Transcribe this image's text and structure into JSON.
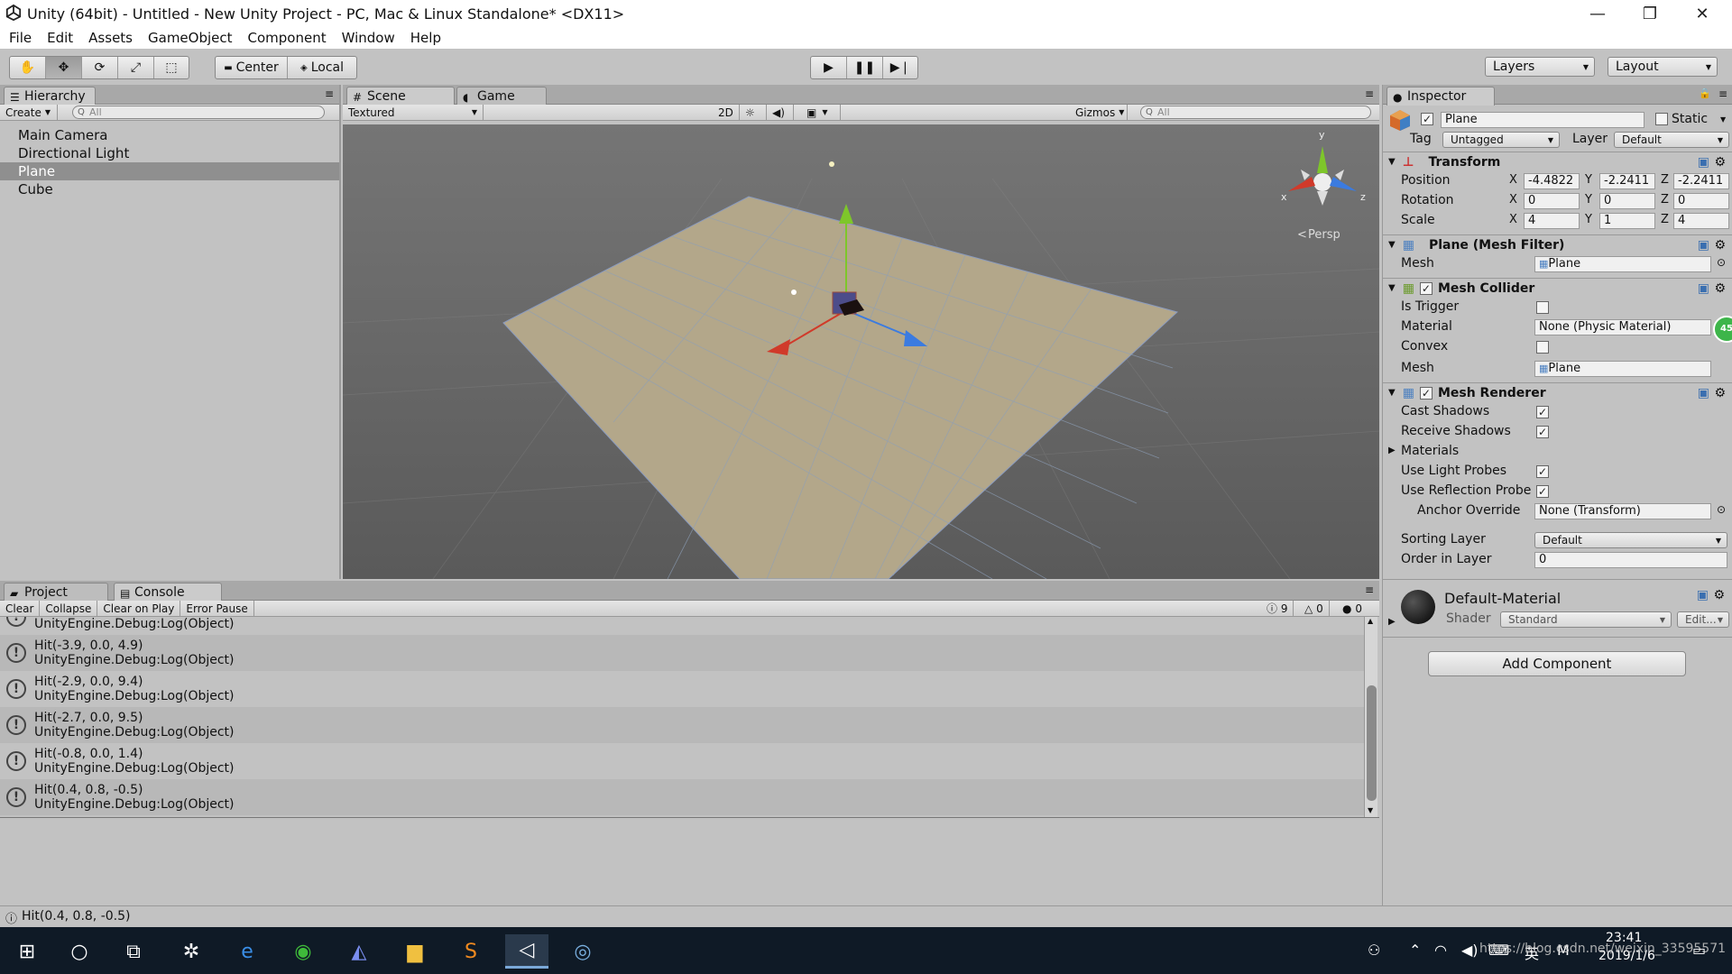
{
  "window": {
    "title": "Unity (64bit) - Untitled - New Unity Project - PC, Mac & Linux Standalone* <DX11>",
    "controls": {
      "minimize": "—",
      "restore": "❐",
      "close": "✕"
    }
  },
  "menu": [
    "File",
    "Edit",
    "Assets",
    "GameObject",
    "Component",
    "Window",
    "Help"
  ],
  "toolbar": {
    "pivot": "Center",
    "space": "Local",
    "layers": "Layers",
    "layout": "Layout"
  },
  "hierarchy": {
    "tab": "Hierarchy",
    "create": "Create",
    "search_placeholder": "All",
    "items": [
      {
        "label": "Main Camera"
      },
      {
        "label": "Directional Light"
      },
      {
        "label": "Plane",
        "selected": true
      },
      {
        "label": "Cube"
      }
    ]
  },
  "scene": {
    "tabs": [
      "Scene",
      "Game"
    ],
    "shading": "Textured",
    "mode_2d": "2D",
    "gizmos": "Gizmos",
    "search_placeholder": "All",
    "persp_label": "Persp",
    "axis_labels": {
      "y": "y",
      "x": "x",
      "z": "z"
    }
  },
  "inspector": {
    "tab": "Inspector",
    "object_name": "Plane",
    "static_label": "Static",
    "tag_label": "Tag",
    "tag_value": "Untagged",
    "layer_label": "Layer",
    "layer_value": "Default",
    "transform": {
      "title": "Transform",
      "position_label": "Position",
      "rotation_label": "Rotation",
      "scale_label": "Scale",
      "position": {
        "x": "-4.4822",
        "y": "-2.2411",
        "z": "-2.2411"
      },
      "rotation": {
        "x": "0",
        "y": "0",
        "z": "0"
      },
      "scale": {
        "x": "4",
        "y": "1",
        "z": "4"
      }
    },
    "mesh_filter": {
      "title": "Plane (Mesh Filter)",
      "mesh_label": "Mesh",
      "mesh_value": "Plane"
    },
    "mesh_collider": {
      "title": "Mesh Collider",
      "is_trigger_label": "Is Trigger",
      "material_label": "Material",
      "material_value": "None (Physic Material)",
      "convex_label": "Convex",
      "mesh_label": "Mesh",
      "mesh_value": "Plane",
      "badge": "45"
    },
    "mesh_renderer": {
      "title": "Mesh Renderer",
      "cast_shadows": "Cast Shadows",
      "receive_shadows": "Receive Shadows",
      "materials": "Materials",
      "use_light_probes": "Use Light Probes",
      "use_reflection_probes": "Use Reflection Probe",
      "anchor_override_label": "Anchor Override",
      "anchor_override_value": "None (Transform)",
      "sorting_layer_label": "Sorting Layer",
      "sorting_layer_value": "Default",
      "order_in_layer_label": "Order in Layer",
      "order_in_layer_value": "0"
    },
    "material": {
      "name": "Default-Material",
      "shader_label": "Shader",
      "shader_value": "Standard",
      "edit_label": "Edit..."
    },
    "add_component": "Add Component"
  },
  "console": {
    "tabs": [
      "Project",
      "Console"
    ],
    "buttons": [
      "Clear",
      "Collapse",
      "Clear on Play",
      "Error Pause"
    ],
    "counts": {
      "logs": "9",
      "warnings": "0",
      "errors": "0"
    },
    "partial_first": "UnityEngine.Debug:Log(Object)",
    "entries": [
      {
        "message": "Hit(-3.9, 0.0, 4.9)",
        "trace": "UnityEngine.Debug:Log(Object)"
      },
      {
        "message": "Hit(-2.9, 0.0, 9.4)",
        "trace": "UnityEngine.Debug:Log(Object)"
      },
      {
        "message": "Hit(-2.7, 0.0, 9.5)",
        "trace": "UnityEngine.Debug:Log(Object)"
      },
      {
        "message": "Hit(-0.8, 0.0, 1.4)",
        "trace": "UnityEngine.Debug:Log(Object)"
      },
      {
        "message": "Hit(0.4, 0.8, -0.5)",
        "trace": "UnityEngine.Debug:Log(Object)"
      }
    ]
  },
  "status": {
    "message": "Hit(0.4, 0.8, -0.5)"
  },
  "taskbar": {
    "time": "23:41",
    "date": "2019/1/6",
    "ime": "英",
    "watermark": "https://blog.csdn.net/weixin_33595571"
  },
  "colors": {
    "accent_red": "#d03a2a",
    "accent_green": "#7ec62a",
    "accent_blue": "#3b7be0",
    "plane": "#b3a78a",
    "selection": "#8f8f8f"
  }
}
